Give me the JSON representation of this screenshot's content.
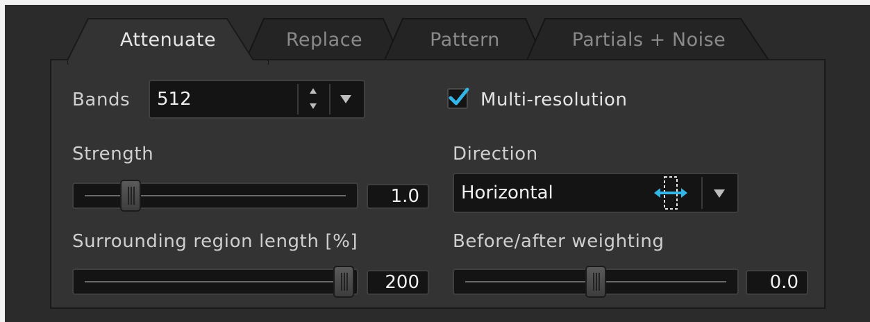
{
  "tabs": [
    {
      "label": "Attenuate",
      "active": true
    },
    {
      "label": "Replace",
      "active": false
    },
    {
      "label": "Pattern",
      "active": false
    },
    {
      "label": "Partials + Noise",
      "active": false
    }
  ],
  "bands": {
    "label": "Bands",
    "value": "512"
  },
  "multi_resolution": {
    "label": "Multi-resolution",
    "checked": true
  },
  "strength": {
    "label": "Strength",
    "value": "1.0",
    "fraction": 0.17
  },
  "direction": {
    "label": "Direction",
    "value": "Horizontal",
    "icon": "horizontal-arrows-icon"
  },
  "surrounding": {
    "label": "Surrounding region length [%]",
    "value": "200",
    "fraction": 1.0
  },
  "weighting": {
    "label": "Before/after weighting",
    "value": "0.0",
    "fraction": 0.5
  },
  "colors": {
    "accent": "#33b5e5",
    "panel": "#2b2b2b",
    "content": "#333333",
    "field": "#141414"
  }
}
